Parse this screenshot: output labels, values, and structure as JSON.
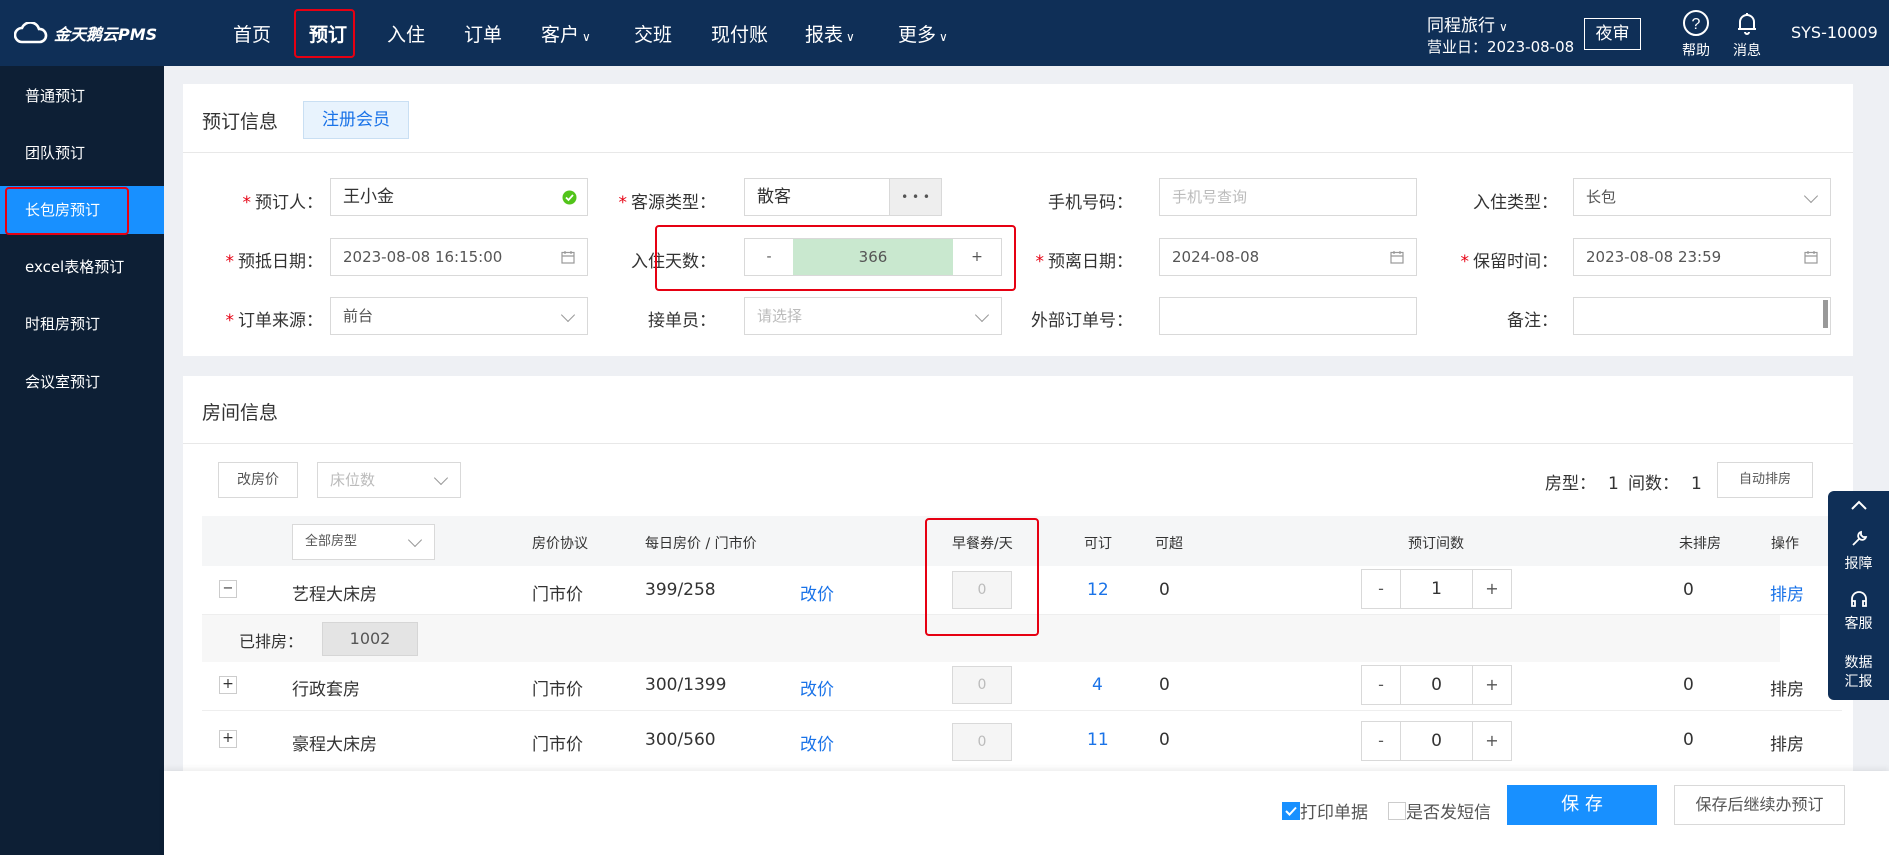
{
  "app": {
    "logo": "金天鹅云PMS"
  },
  "nav": {
    "items": [
      {
        "label": "首页"
      },
      {
        "label": "预订"
      },
      {
        "label": "入住"
      },
      {
        "label": "订单"
      },
      {
        "label": "客户"
      },
      {
        "label": "交班"
      },
      {
        "label": "现付账"
      },
      {
        "label": "报表"
      },
      {
        "label": "更多"
      }
    ]
  },
  "topright": {
    "hotel": "同程旅行",
    "business_day": "营业日：2023-08-08",
    "night_audit": "夜审",
    "help": "帮助",
    "messages": "消息",
    "user": "SYS-10009"
  },
  "sidebar": {
    "items": [
      {
        "label": "普通预订"
      },
      {
        "label": "团队预订"
      },
      {
        "label": "长包房预订"
      },
      {
        "label": "excel表格预订"
      },
      {
        "label": "时租房预订"
      },
      {
        "label": "会议室预订"
      }
    ]
  },
  "booking": {
    "title": "预订信息",
    "register_btn": "注册会员",
    "booker_label": "预订人：",
    "booker": "王小金",
    "source_type_label": "客源类型：",
    "source_type": "散客",
    "more_btn": "• • •",
    "phone_label": "手机号码：",
    "phone_ph": "手机号查询",
    "checkin_type_label": "入住类型：",
    "checkin_type": "长包",
    "arrival_label": "预抵日期：",
    "arrival": "2023-08-08 16:15:00",
    "days_label": "入住天数：",
    "days": "366",
    "departure_label": "预离日期：",
    "departure": "2024-08-08",
    "hold_label": "保留时间：",
    "hold": "2023-08-08 23:59",
    "channel_label": "订单来源：",
    "channel": "前台",
    "taker_label": "接单员：",
    "taker_ph": "请选择",
    "ext_label": "外部订单号：",
    "remark_label": "备注："
  },
  "rooms": {
    "title": "房间信息",
    "change_price_btn": "改房价",
    "beds_ph": "床位数",
    "room_type_summary_label": "房型：",
    "room_type_count": "1",
    "room_count_label": "间数：",
    "room_count": "1",
    "auto_assign_btn": "自动排房",
    "headers": {
      "room_type": "全部房型",
      "protocol": "房价协议",
      "price": "每日房价 / 门市价",
      "breakfast": "早餐券/天",
      "bookable": "可订",
      "overbook": "可超",
      "rooms": "预订间数",
      "unassigned": "未排房",
      "action": "操作"
    },
    "assigned_label": "已排房：",
    "rows": [
      {
        "toggle": "−",
        "name": "艺程大床房",
        "protocol": "门市价",
        "price": "399/258",
        "edit": "改价",
        "breakfast": "0",
        "bookable": "12",
        "overbook": "0",
        "count": "1",
        "unassigned": "0",
        "action": "排房",
        "assigned": "1002"
      },
      {
        "toggle": "+",
        "name": "行政套房",
        "protocol": "门市价",
        "price": "300/1399",
        "edit": "改价",
        "breakfast": "0",
        "bookable": "4",
        "overbook": "0",
        "count": "0",
        "unassigned": "0",
        "action": "排房"
      },
      {
        "toggle": "+",
        "name": "豪程大床房",
        "protocol": "门市价",
        "price": "300/560",
        "edit": "改价",
        "breakfast": "0",
        "bookable": "11",
        "overbook": "0",
        "count": "0",
        "unassigned": "0",
        "action": "排房"
      }
    ]
  },
  "footer": {
    "print": "打印单据",
    "sms": "是否发短信",
    "save": "保 存",
    "save_continue": "保存后继续办预订"
  },
  "rightpanel": {
    "report": "报障",
    "service": "客服",
    "data1": "数据",
    "data2": "汇报"
  }
}
